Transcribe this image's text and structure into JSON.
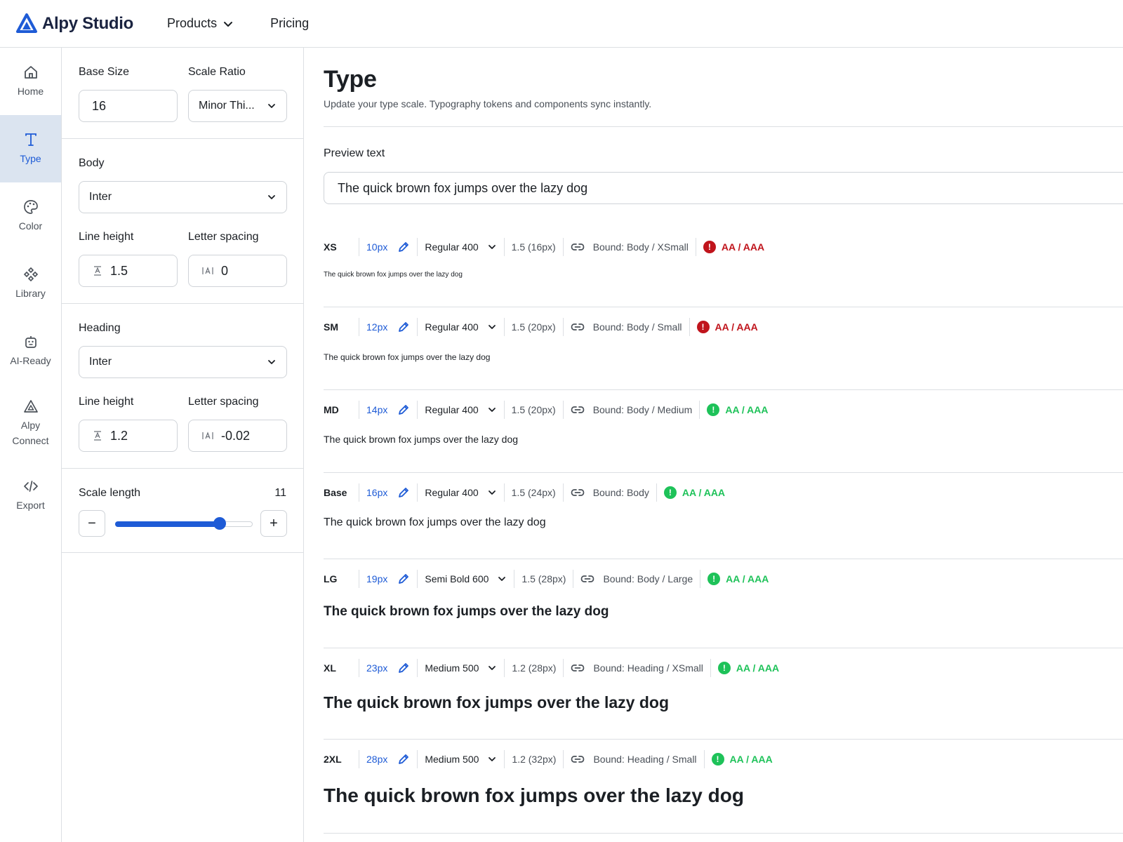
{
  "header": {
    "brand": "Alpy Studio",
    "nav": {
      "products": "Products",
      "pricing": "Pricing"
    }
  },
  "rail": {
    "items": [
      {
        "label": "Home",
        "icon": "home-icon"
      },
      {
        "label": "Type",
        "icon": "type-icon"
      },
      {
        "label": "Color",
        "icon": "palette-icon"
      },
      {
        "label": "Library",
        "icon": "components-icon"
      },
      {
        "label": "AI-Ready",
        "icon": "robot-icon"
      },
      {
        "label": "Alpy\nConnect",
        "icon": "alpy-connect-icon"
      },
      {
        "label": "Export",
        "icon": "code-icon"
      }
    ]
  },
  "settings": {
    "base_size_label": "Base Size",
    "base_size_value": "16",
    "scale_ratio_label": "Scale Ratio",
    "scale_ratio_value": "Minor Thi...",
    "body": {
      "title": "Body",
      "font": "Inter",
      "line_height_label": "Line height",
      "line_height_value": "1.5",
      "letter_spacing_label": "Letter spacing",
      "letter_spacing_value": "0"
    },
    "heading": {
      "title": "Heading",
      "font": "Inter",
      "line_height_label": "Line height",
      "line_height_value": "1.2",
      "letter_spacing_label": "Letter spacing",
      "letter_spacing_value": "-0.02"
    },
    "scale_length": {
      "label": "Scale length",
      "value": "11",
      "level": 0.76,
      "minus": "−",
      "plus": "+"
    }
  },
  "main": {
    "title": "Type",
    "subtitle": "Update your type scale. Typography tokens and components sync instantly.",
    "preview_label": "Preview text",
    "preview_value": "The quick brown fox jumps over the lazy dog"
  },
  "type_scale": [
    {
      "token": "XS",
      "size": "10px",
      "weight": "Regular 400",
      "line_height": "1.5 (16px)",
      "bound": "Bound: Body / XSmall",
      "contrast": "AA / AAA",
      "status": "fail",
      "sample": "The quick brown fox jumps over the lazy dog"
    },
    {
      "token": "SM",
      "size": "12px",
      "weight": "Regular 400",
      "line_height": "1.5 (20px)",
      "bound": "Bound: Body / Small",
      "contrast": "AA / AAA",
      "status": "fail",
      "sample": "The quick brown fox jumps over the lazy dog"
    },
    {
      "token": "MD",
      "size": "14px",
      "weight": "Regular 400",
      "line_height": "1.5 (20px)",
      "bound": "Bound: Body / Medium",
      "contrast": "AA / AAA",
      "status": "pass",
      "sample": "The quick brown fox jumps over the lazy dog"
    },
    {
      "token": "Base",
      "size": "16px",
      "weight": "Regular 400",
      "line_height": "1.5 (24px)",
      "bound": "Bound: Body",
      "contrast": "AA / AAA",
      "status": "pass",
      "sample": "The quick brown fox jumps over the lazy dog"
    },
    {
      "token": "LG",
      "size": "19px",
      "weight": "Semi Bold 600",
      "line_height": "1.5 (28px)",
      "bound": "Bound: Body / Large",
      "contrast": "AA / AAA",
      "status": "pass",
      "sample": "The quick brown fox jumps over the lazy dog"
    },
    {
      "token": "XL",
      "size": "23px",
      "weight": "Medium 500",
      "line_height": "1.2 (28px)",
      "bound": "Bound: Heading / XSmall",
      "contrast": "AA / AAA",
      "status": "pass",
      "sample": "The quick brown fox jumps over the lazy dog"
    },
    {
      "token": "2XL",
      "size": "28px",
      "weight": "Medium 500",
      "line_height": "1.2 (32px)",
      "bound": "Bound: Heading / Small",
      "contrast": "AA / AAA",
      "status": "pass",
      "sample": "The quick brown fox jumps over the lazy dog"
    }
  ],
  "colors": {
    "accent": "#1e5bd6",
    "fail": "#c0141c",
    "pass": "#1ec259",
    "active_rail_bg": "#dbe4f0"
  }
}
